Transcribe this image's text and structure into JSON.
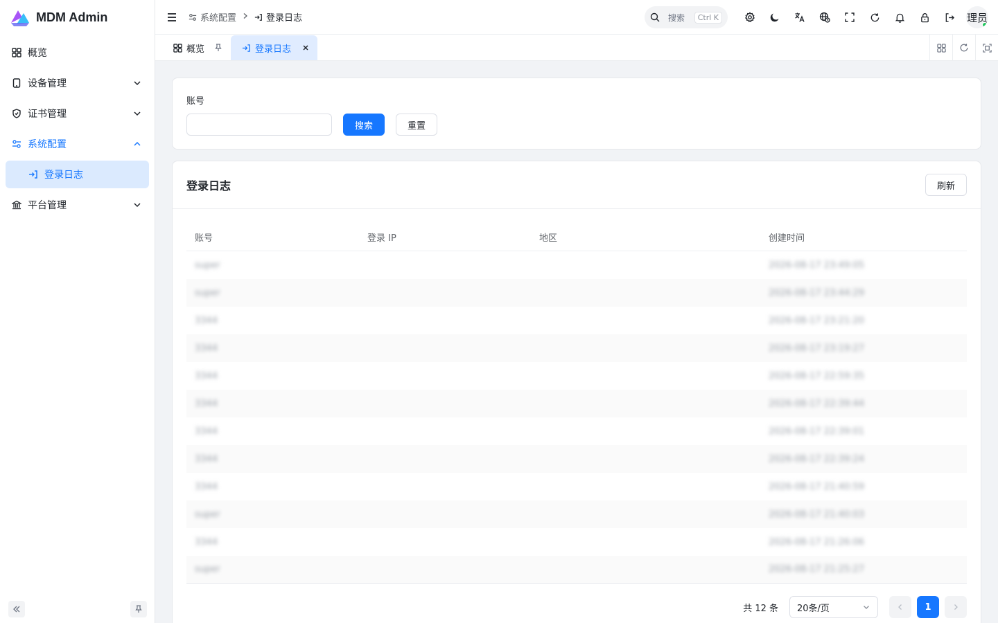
{
  "app": {
    "title": "MDM Admin"
  },
  "sidebar": {
    "items": [
      {
        "label": "概览",
        "icon": "grid-icon"
      },
      {
        "label": "设备管理",
        "icon": "tablet-icon"
      },
      {
        "label": "证书管理",
        "icon": "shield-icon"
      },
      {
        "label": "系统配置",
        "icon": "settings-sliders-icon",
        "expanded": true
      },
      {
        "label": "登录日志",
        "icon": "login-icon",
        "selected": true
      },
      {
        "label": "平台管理",
        "icon": "bank-icon"
      }
    ]
  },
  "header": {
    "breadcrumb": [
      "系统配置",
      "登录日志"
    ],
    "search_label": "搜索",
    "search_shortcut": "Ctrl K",
    "avatar_text": "理员"
  },
  "tabs": [
    {
      "label": "概览",
      "pinned": true
    },
    {
      "label": "登录日志",
      "active": true
    }
  ],
  "filter": {
    "account_label": "账号",
    "account_value": "",
    "search_button": "搜索",
    "reset_button": "重置"
  },
  "table_card": {
    "title": "登录日志",
    "refresh_button": "刷新",
    "columns": [
      "账号",
      "登录 IP",
      "地区",
      "创建时间"
    ],
    "rows": [
      {
        "account": "super",
        "ip": "",
        "region": "",
        "created": "2026-08-17 23:49:05"
      },
      {
        "account": "super",
        "ip": "",
        "region": "",
        "created": "2026-08-17 23:44:29"
      },
      {
        "account": "3344",
        "ip": "",
        "region": "",
        "created": "2026-08-17 23:21:20"
      },
      {
        "account": "3344",
        "ip": "",
        "region": "",
        "created": "2026-08-17 23:19:27"
      },
      {
        "account": "3344",
        "ip": "",
        "region": "",
        "created": "2026-08-17 22:59:35"
      },
      {
        "account": "3344",
        "ip": "",
        "region": "",
        "created": "2026-08-17 22:39:44"
      },
      {
        "account": "3344",
        "ip": "",
        "region": "",
        "created": "2026-08-17 22:39:01"
      },
      {
        "account": "3344",
        "ip": "",
        "region": "",
        "created": "2026-08-17 22:39:24"
      },
      {
        "account": "3344",
        "ip": "",
        "region": "",
        "created": "2026-08-17 21:40:59"
      },
      {
        "account": "super",
        "ip": "",
        "region": "",
        "created": "2026-08-17 21:40:03"
      },
      {
        "account": "3344",
        "ip": "",
        "region": "",
        "created": "2026-08-17 21:26:06"
      },
      {
        "account": "super",
        "ip": "",
        "region": "",
        "created": "2026-08-17 21:25:27"
      }
    ]
  },
  "pagination": {
    "total_text": "共 12 条",
    "page_size": "20条/页",
    "current_page": "1"
  },
  "colors": {
    "primary": "#1677ff",
    "selected_bg": "#dbeafe"
  }
}
